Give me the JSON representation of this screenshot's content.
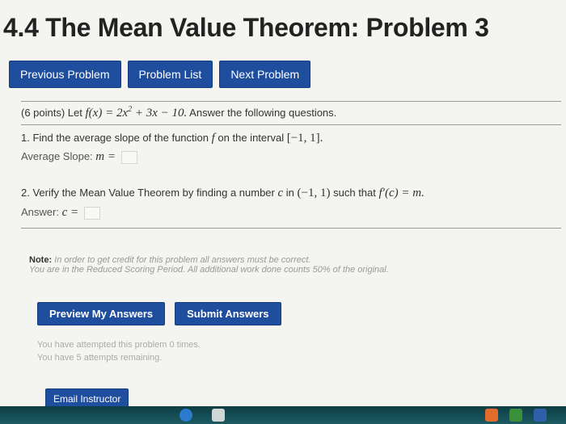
{
  "page": {
    "title": "4.4 The Mean Value Theorem: Problem 3"
  },
  "nav": {
    "previous": "Previous Problem",
    "list": "Problem List",
    "next": "Next Problem"
  },
  "problem": {
    "points": "(6 points) Let",
    "func_lhs": "f(x) = 2x",
    "func_exp": "2",
    "func_rhs": " + 3x − 10.",
    "instruction": "Answer the following questions.",
    "part1_prefix": "1. Find the average slope of the function",
    "part1_func": "f",
    "part1_mid": "on the interval",
    "part1_interval": "[−1, 1].",
    "part1_label": "Average Slope:",
    "part1_var": "m =",
    "part2_prefix": "2. Verify the Mean Value Theorem by finding a number",
    "part2_c": "c",
    "part2_in": "in",
    "part2_interval": "(−1, 1)",
    "part2_mid": "such that",
    "part2_expr": "f′(c) = m.",
    "part2_label": "Answer:",
    "part2_var": "c ="
  },
  "note": {
    "label": "Note:",
    "line1": "In order to get credit for this problem all answers must be correct.",
    "line2": "You are in the Reduced Scoring Period. All additional work done counts 50% of the original."
  },
  "actions": {
    "preview": "Preview My Answers",
    "submit": "Submit Answers"
  },
  "attempts": {
    "line1": "You have attempted this problem 0 times.",
    "line2": "You have 5 attempts remaining."
  },
  "email": {
    "label": "Email Instructor"
  },
  "colors": {
    "button_blue": "#1f4e9e",
    "background": "#f4f4f0"
  }
}
